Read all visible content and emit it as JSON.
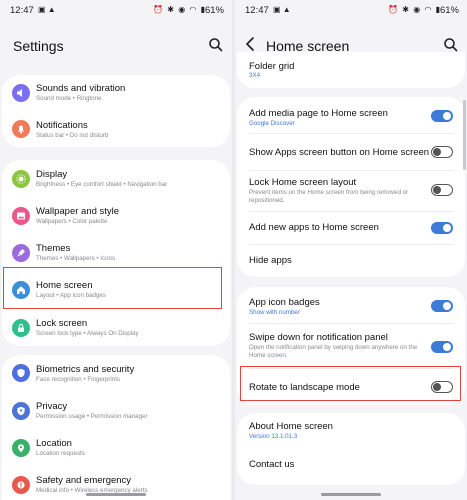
{
  "left": {
    "status": {
      "time": "12:47",
      "battery": "61%"
    },
    "title": "Settings",
    "groups": [
      [
        {
          "label": "Sounds and vibration",
          "sub": "Sound mode  •  Ringtone",
          "color": "#7b6ff0",
          "icon": "speaker-icon"
        },
        {
          "label": "Notifications",
          "sub": "Status bar  •  Do not disturb",
          "color": "#f07a5a",
          "icon": "bell-icon"
        }
      ],
      [
        {
          "label": "Display",
          "sub": "Brightness  •  Eye comfort shield  •  Navigation bar",
          "color": "#8cc63f",
          "icon": "sun-icon"
        },
        {
          "label": "Wallpaper and style",
          "sub": "Wallpapers  •  Color palette",
          "color": "#e8588a",
          "icon": "image-icon"
        },
        {
          "label": "Themes",
          "sub": "Themes  •  Wallpapers  •  Icons",
          "color": "#9b6bde",
          "icon": "brush-icon"
        },
        {
          "label": "Home screen",
          "sub": "Layout  •  App icon badges",
          "color": "#3b8ed8",
          "icon": "home-icon"
        },
        {
          "label": "Lock screen",
          "sub": "Screen lock type  •  Always On Display",
          "color": "#2ebf8c",
          "icon": "lock-icon"
        }
      ],
      [
        {
          "label": "Biometrics and security",
          "sub": "Face recognition  •  Fingerprints",
          "color": "#4d6fe0",
          "icon": "shield-icon"
        },
        {
          "label": "Privacy",
          "sub": "Permission usage  •  Permission manager",
          "color": "#4a74d6",
          "icon": "privacy-icon"
        },
        {
          "label": "Location",
          "sub": "Location requests",
          "color": "#38b26a",
          "icon": "location-pin-icon"
        },
        {
          "label": "Safety and emergency",
          "sub": "Medical info  •  Wireless emergency alerts",
          "color": "#e65a4c",
          "icon": "emergency-icon"
        }
      ]
    ]
  },
  "right": {
    "status": {
      "time": "12:47",
      "battery": "61%"
    },
    "title": "Home screen",
    "partial": {
      "label": "Folder grid",
      "sub": "3X4"
    },
    "items": [
      {
        "label": "Add media page to Home screen",
        "sub": "Google Discover",
        "sub_blue": true,
        "toggle": "on"
      },
      {
        "label": "Show Apps screen button on Home screen",
        "sub": "",
        "toggle": "off"
      },
      {
        "label": "Lock Home screen layout",
        "sub": "Prevent items on the Home screen from being removed or repositioned.",
        "toggle": "off"
      },
      {
        "label": "Add new apps to Home screen",
        "sub": "",
        "toggle": "on"
      },
      {
        "label": "Hide apps",
        "sub": "",
        "toggle": ""
      },
      {
        "label": "App icon badges",
        "sub": "Show with number",
        "sub_blue": true,
        "toggle": "on"
      },
      {
        "label": "Swipe down for notification panel",
        "sub": "Open the notification panel by swiping down anywhere on the Home screen.",
        "toggle": "on"
      },
      {
        "label": "Rotate to landscape mode",
        "sub": "",
        "toggle": "off"
      },
      {
        "label": "About Home screen",
        "sub": "Version 13.1.01.3",
        "sub_blue": true,
        "toggle": ""
      },
      {
        "label": "Contact us",
        "sub": "",
        "toggle": ""
      }
    ]
  },
  "colors": {
    "accent": "#3e7ad8",
    "highlight": "#e0443c"
  }
}
